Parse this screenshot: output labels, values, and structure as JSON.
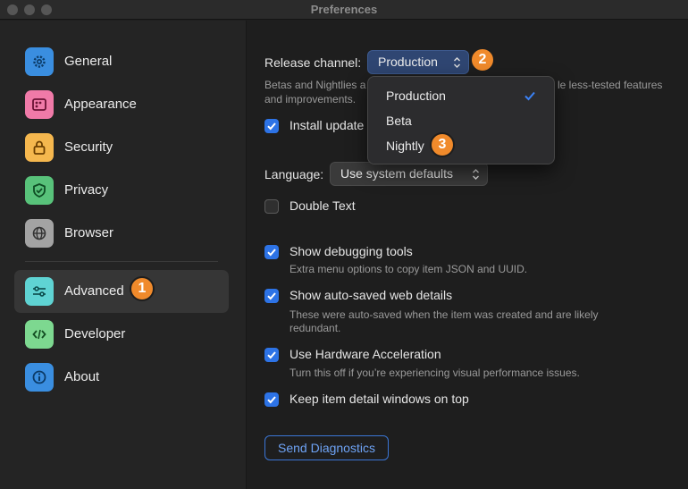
{
  "window": {
    "title": "Preferences"
  },
  "sidebar": {
    "items": [
      {
        "label": "General",
        "icon": "gear-icon",
        "color": "#4ea8f0"
      },
      {
        "label": "Appearance",
        "icon": "palette-icon",
        "color": "#f07aa8"
      },
      {
        "label": "Security",
        "icon": "lock-icon",
        "color": "#f5b74e"
      },
      {
        "label": "Privacy",
        "icon": "shield-check-icon",
        "color": "#58c27a"
      },
      {
        "label": "Browser",
        "icon": "globe-icon",
        "color": "#a3a3a3"
      },
      {
        "label": "Advanced",
        "icon": "sliders-icon",
        "color": "#5fd3d3",
        "selected": true
      },
      {
        "label": "Developer",
        "icon": "code-icon",
        "color": "#7dd890"
      },
      {
        "label": "About",
        "icon": "info-icon",
        "color": "#4ea8f0"
      }
    ]
  },
  "annotations": {
    "badge1": "1",
    "badge2": "2",
    "badge3": "3"
  },
  "release": {
    "label": "Release channel:",
    "value": "Production",
    "description_line1": "Betas and Nightlies a",
    "description_line1_tail": "le less-tested features",
    "description_line2": "and improvements.",
    "options": [
      "Production",
      "Beta",
      "Nightly"
    ],
    "selected_option": "Production"
  },
  "install_updates": {
    "label": "Install update",
    "checked": true
  },
  "language": {
    "label": "Language:",
    "value": "Use system defaults"
  },
  "double_text": {
    "label": "Double Text",
    "checked": false
  },
  "debug_tools": {
    "label": "Show debugging tools",
    "checked": true,
    "description": "Extra menu options to copy item JSON and UUID."
  },
  "autosaved": {
    "label": "Show auto-saved web details",
    "checked": true,
    "description_line1": "These were auto-saved when the item was created and are likely",
    "description_line2": "redundant."
  },
  "hw_accel": {
    "label": "Use Hardware Acceleration",
    "checked": true,
    "description": "Turn this off if you’re experiencing visual performance issues."
  },
  "keep_on_top": {
    "label": "Keep item detail windows on top",
    "checked": true
  },
  "diagnostics": {
    "label": "Send Diagnostics"
  },
  "colors": {
    "accent": "#2d73e6",
    "badge": "#f08a2b",
    "link": "#6ea3f5"
  }
}
